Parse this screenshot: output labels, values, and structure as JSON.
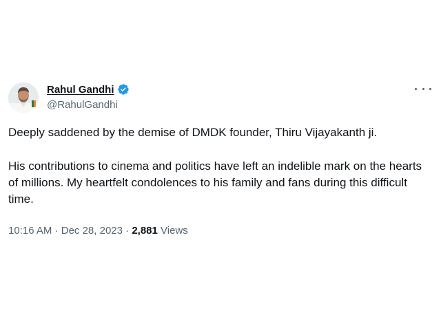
{
  "tweet": {
    "author": {
      "display_name": "Rahul Gandhi",
      "handle": "@RahulGandhi",
      "verified": true,
      "avatar_icon": "profile-photo-icon"
    },
    "more_icon": "ellipsis-icon",
    "paragraphs": [
      "Deeply saddened by the demise of DMDK founder, Thiru Vijayakanth ji.",
      "His contributions to cinema and politics have left an indelible mark on the hearts of millions. My heartfelt condolences to his family and fans during this difficult time."
    ],
    "meta": {
      "time": "10:16 AM",
      "separator": " · ",
      "date": "Dec 28, 2023",
      "views_count": "2,881",
      "views_label": "Views"
    }
  },
  "colors": {
    "text_primary": "#0f1419",
    "text_secondary": "#536471",
    "verified_blue": "#1d9bf0",
    "background": "#ffffff"
  }
}
